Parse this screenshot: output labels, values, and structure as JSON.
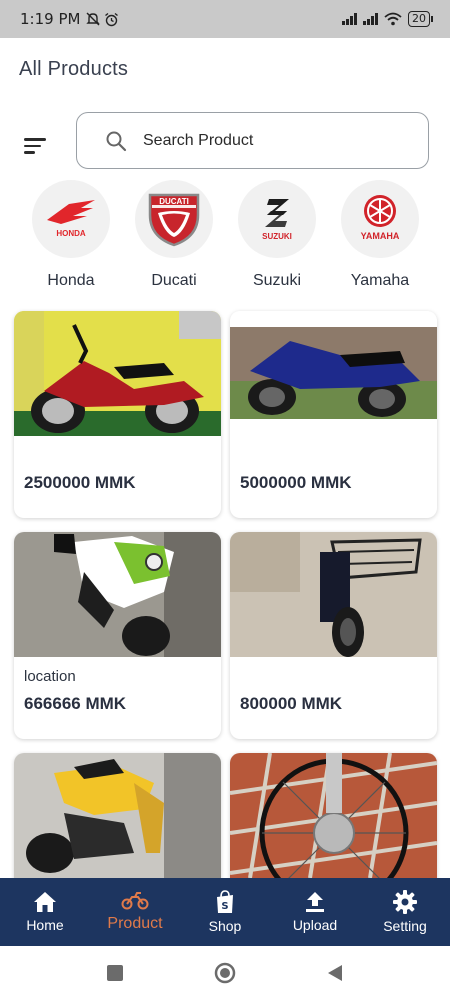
{
  "status_bar": {
    "time": "1:19 PM",
    "battery": "20"
  },
  "page": {
    "title": "All Products"
  },
  "search": {
    "placeholder": "Search Product"
  },
  "brands": [
    {
      "name": "Honda",
      "logo_text": "HONDA"
    },
    {
      "name": "Ducati",
      "logo_text": "DUCATI"
    },
    {
      "name": "Suzuki",
      "logo_text": "SUZUKI"
    },
    {
      "name": "Yamaha",
      "logo_text": "YAMAHA"
    }
  ],
  "products": [
    {
      "location": "",
      "price": "2500000 MMK"
    },
    {
      "location": "",
      "price": "5000000 MMK"
    },
    {
      "location": "location",
      "price": "666666 MMK"
    },
    {
      "location": "",
      "price": "800000 MMK"
    },
    {
      "location": "",
      "price": ""
    },
    {
      "location": "",
      "price": ""
    }
  ],
  "nav": [
    {
      "label": "Home",
      "icon": "home-icon"
    },
    {
      "label": "Product",
      "icon": "motorbike-icon"
    },
    {
      "label": "Shop",
      "icon": "shopping-bag-icon"
    },
    {
      "label": "Upload",
      "icon": "upload-icon"
    },
    {
      "label": "Setting",
      "icon": "gear-icon"
    }
  ],
  "colors": {
    "nav_bg": "#1d3560",
    "accent": "#e07a4a"
  }
}
